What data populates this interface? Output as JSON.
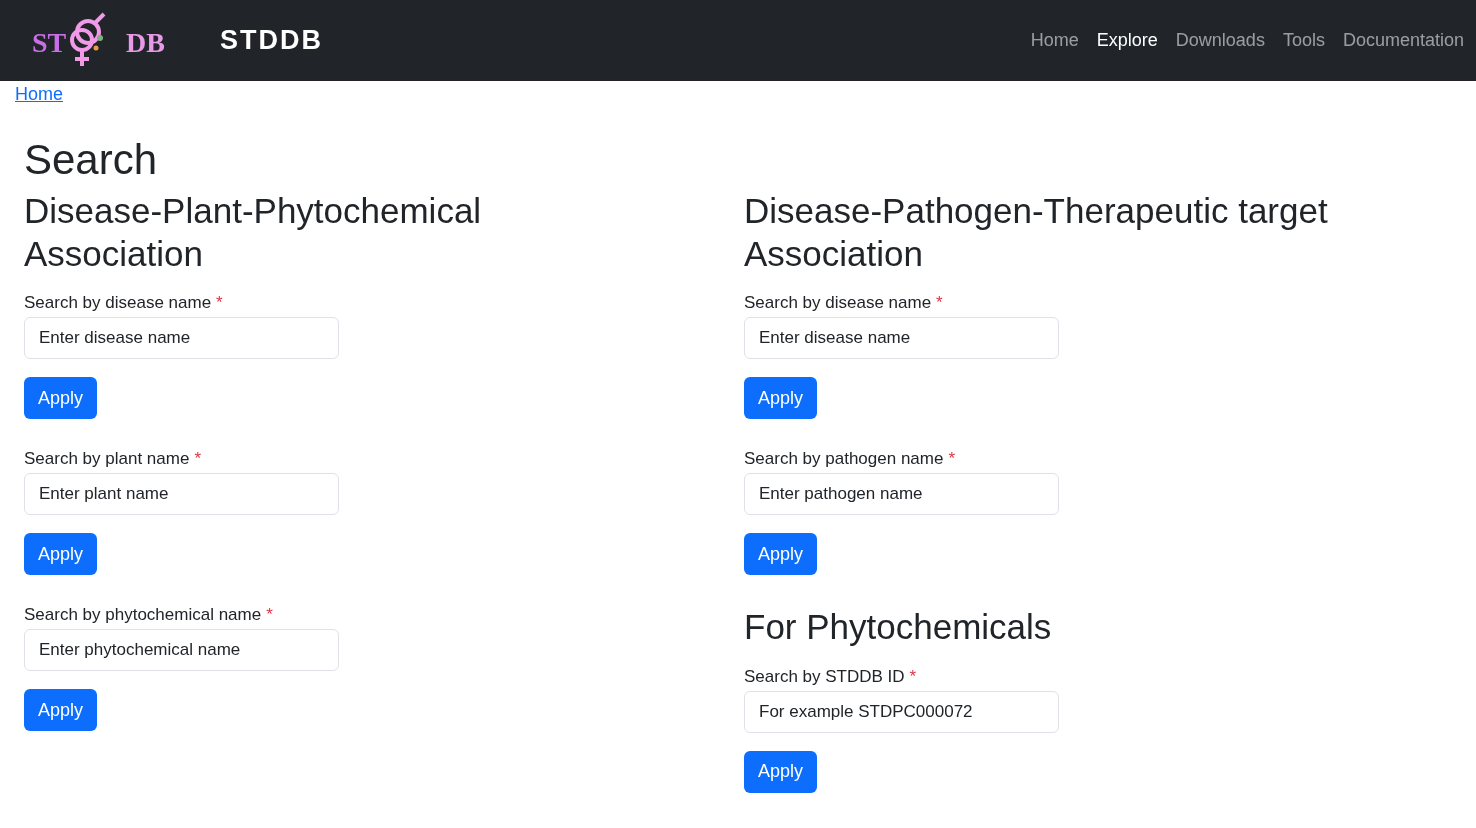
{
  "navbar": {
    "logo": {
      "left": "ST",
      "right": "DB"
    },
    "brand": "STDDB",
    "links": [
      {
        "label": "Home",
        "selected": false
      },
      {
        "label": "Explore",
        "selected": true
      },
      {
        "label": "Downloads",
        "selected": false
      },
      {
        "label": "Tools",
        "selected": false
      },
      {
        "label": "Documentation",
        "selected": false
      }
    ]
  },
  "breadcrumb": [
    "Home"
  ],
  "page_title": "Search",
  "columns": [
    {
      "sections": [
        {
          "title": "Disease-Plant-Phytochemical Association",
          "searches": [
            {
              "label": "Search by disease name",
              "required_mark": "*",
              "placeholder": "Enter disease name",
              "button": "Apply"
            },
            {
              "label": "Search by plant name",
              "required_mark": "*",
              "placeholder": "Enter plant name",
              "button": "Apply"
            },
            {
              "label": "Search by phytochemical name",
              "required_mark": "*",
              "placeholder": "Enter phytochemical name",
              "button": "Apply"
            }
          ]
        }
      ]
    },
    {
      "sections": [
        {
          "title": "Disease-Pathogen-Therapeutic target Association",
          "searches": [
            {
              "label": "Search by disease name",
              "required_mark": "*",
              "placeholder": "Enter disease name",
              "button": "Apply"
            },
            {
              "label": "Search by pathogen name",
              "required_mark": "*",
              "placeholder": "Enter pathogen name",
              "button": "Apply"
            }
          ]
        },
        {
          "title": "For Phytochemicals",
          "searches": [
            {
              "label": "Search by STDDB ID",
              "required_mark": "*",
              "placeholder": "For example STDPC000072",
              "button": "Apply"
            }
          ]
        }
      ]
    }
  ]
}
